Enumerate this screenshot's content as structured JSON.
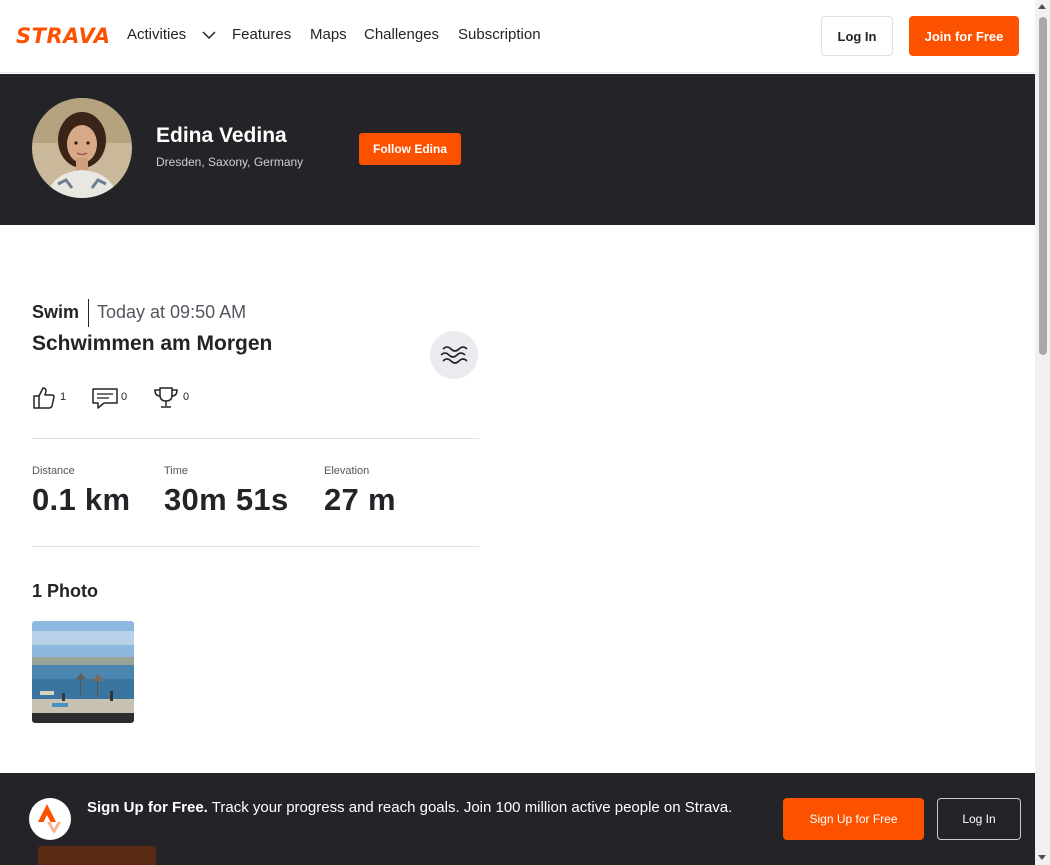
{
  "nav": {
    "logo": "STRAVA",
    "items": [
      "Activities",
      "Features",
      "Maps",
      "Challenges",
      "Subscription"
    ],
    "login_label": "Log In",
    "join_label": "Join for Free"
  },
  "athlete": {
    "name": "Edina Vedina",
    "location": "Dresden, Saxony, Germany",
    "follow_label": "Follow Edina"
  },
  "activity": {
    "type": "Swim",
    "date": "Today at 09:50 AM",
    "title": "Schwimmen am Morgen",
    "sport_icon": "swim-waves-icon",
    "kudos": "1",
    "comments": "0",
    "achievements": "0"
  },
  "metrics": [
    {
      "label": "Distance",
      "value": "0.1 km"
    },
    {
      "label": "Time",
      "value": "30m 51s"
    },
    {
      "label": "Elevation",
      "value": "27 m"
    }
  ],
  "photos": {
    "title": "1 Photo"
  },
  "banner": {
    "headline": "Sign Up for Free.",
    "text": "Track your progress and reach goals. Join 100 million active people on Strava.",
    "signup_label": "Sign Up for Free",
    "login_label": "Log In"
  },
  "colors": {
    "brand": "#fc5200",
    "dark": "#242428"
  }
}
